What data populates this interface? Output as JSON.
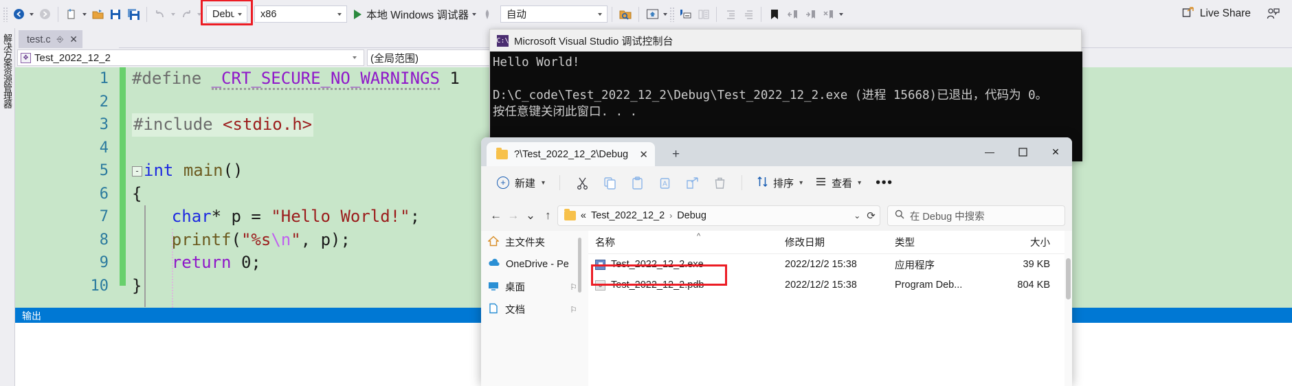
{
  "vs": {
    "toolbar": {
      "nav_back_icon": "navigate-back-icon",
      "nav_forward_icon": "navigate-forward-icon",
      "new_item_icon": "new-item-icon",
      "open_icon": "open-file-icon",
      "save_icon": "save-icon",
      "save_all_icon": "save-all-icon",
      "undo_icon": "undo-icon",
      "redo_icon": "redo-icon",
      "config_value": "Debug",
      "platform_value": "x86",
      "run_label": "本地 Windows 调试器",
      "hot_reload_icon": "hot-reload-icon",
      "auto_value": "自动",
      "find_in_files_icon": "find-in-files-icon",
      "window_layout_icon": "window-layout-icon",
      "comment_icon": "comment-icon",
      "uncomment_icon": "uncomment-icon",
      "indent_icon": "increase-indent-icon",
      "outdent_icon": "decrease-indent-icon",
      "bookmark_icon": "bookmark-icon",
      "prev_bookmark_icon": "previous-bookmark-icon",
      "next_bookmark_icon": "next-bookmark-icon",
      "clear_bookmark_icon": "clear-bookmarks-icon",
      "live_share_label": "Live Share",
      "live_share_icon": "live-share-icon",
      "feedback_icon": "send-feedback-icon"
    },
    "left_dock_label": "解决方案资源管理器",
    "tab": {
      "name": "test.c",
      "pin_icon": "pin-icon",
      "close_icon": "close-icon"
    },
    "navbar": {
      "type_value": "Test_2022_12_2",
      "type_icon": "project-icon",
      "scope_value": "(全局范围)"
    },
    "output_pane": {
      "tab_label": "输出"
    },
    "code": {
      "line_numbers": [
        "1",
        "2",
        "3",
        "4",
        "5",
        "6",
        "7",
        "8",
        "9",
        "10"
      ],
      "lines": [
        {
          "n": 1,
          "tokens": [
            {
              "t": "#define ",
              "c": "k-grey"
            },
            {
              "t": "_CRT_SECURE_NO_WARNINGS",
              "c": "k-macro squig"
            },
            {
              "t": " ",
              "c": "k-plain"
            },
            {
              "t": "1",
              "c": "k-plain"
            }
          ]
        },
        {
          "n": 2,
          "tokens": []
        },
        {
          "n": 3,
          "highlight": true,
          "tokens": [
            {
              "t": "#include ",
              "c": "k-grey"
            },
            {
              "t": "<stdio.h>",
              "c": "k-str"
            }
          ]
        },
        {
          "n": 4,
          "tokens": []
        },
        {
          "n": 5,
          "fold": "-",
          "tokens": [
            {
              "t": "int",
              "c": "k-blue"
            },
            {
              "t": " ",
              "c": "k-plain"
            },
            {
              "t": "main",
              "c": "k-fn"
            },
            {
              "t": "()",
              "c": "k-plain"
            }
          ]
        },
        {
          "n": 6,
          "tokens": [
            {
              "t": "{",
              "c": "k-plain"
            }
          ]
        },
        {
          "n": 7,
          "tokens": [
            {
              "t": "    ",
              "c": "k-plain"
            },
            {
              "t": "char",
              "c": "k-blue"
            },
            {
              "t": "* ",
              "c": "k-plain"
            },
            {
              "t": "p",
              "c": "k-plain"
            },
            {
              "t": " = ",
              "c": "k-plain"
            },
            {
              "t": "\"Hello World!\"",
              "c": "k-str"
            },
            {
              "t": ";",
              "c": "k-plain"
            }
          ]
        },
        {
          "n": 8,
          "tokens": [
            {
              "t": "    ",
              "c": "k-plain"
            },
            {
              "t": "printf",
              "c": "k-fn"
            },
            {
              "t": "(",
              "c": "k-plain"
            },
            {
              "t": "\"%s",
              "c": "k-str"
            },
            {
              "t": "\\n",
              "c": "k-esc"
            },
            {
              "t": "\"",
              "c": "k-str"
            },
            {
              "t": ", ",
              "c": "k-plain"
            },
            {
              "t": "p",
              "c": "k-plain"
            },
            {
              "t": ");",
              "c": "k-plain"
            }
          ]
        },
        {
          "n": 9,
          "tokens": [
            {
              "t": "    ",
              "c": "k-plain"
            },
            {
              "t": "return",
              "c": "k-purple"
            },
            {
              "t": " 0;",
              "c": "k-plain"
            }
          ]
        },
        {
          "n": 10,
          "tokens": [
            {
              "t": "}",
              "c": "k-plain"
            }
          ]
        }
      ]
    }
  },
  "console": {
    "title": "Microsoft Visual Studio 调试控制台",
    "icon": "console-app-icon",
    "line1": "Hello World!",
    "line2": "",
    "line3": "D:\\C_code\\Test_2022_12_2\\Debug\\Test_2022_12_2.exe (进程 15668)已退出，代码为 0。",
    "line4": "按任意键关闭此窗口. . ."
  },
  "explorer": {
    "tab_title": "?\\Test_2022_12_2\\Debug",
    "tab_folder_icon": "folder-icon",
    "tab_close_icon": "close-icon",
    "new_tab_icon": "new-tab-plus-icon",
    "minimize_icon": "minimize-icon",
    "maximize_icon": "maximize-icon",
    "close_icon": "window-close-icon",
    "minimize_glyph": "—",
    "maximize_glyph": "☐",
    "close_glyph": "✕",
    "toolbar": {
      "new_label": "新建",
      "new_icon": "new-plus-circle-icon",
      "cut_icon": "cut-icon",
      "copy_icon": "copy-icon",
      "paste_icon": "paste-icon",
      "rename_icon": "rename-icon",
      "share_icon": "share-icon",
      "delete_icon": "trash-icon",
      "sort_label": "排序",
      "sort_icon": "sort-arrows-icon",
      "view_label": "查看",
      "view_icon": "view-list-icon",
      "more_label": "•••",
      "more_icon": "more-options-icon"
    },
    "address": {
      "back_icon": "back-arrow-icon",
      "forward_icon": "forward-arrow-icon",
      "recent_icon": "recent-dropdown-icon",
      "up_icon": "up-arrow-icon",
      "folder_icon": "folder-icon",
      "prefix": "«",
      "crumb1": "Test_2022_12_2",
      "crumb2": "Debug",
      "separator": "›",
      "dropdown_icon": "chevron-down-icon",
      "refresh_icon": "refresh-icon",
      "refresh_glyph": "⟳",
      "search_icon": "search-icon",
      "search_placeholder": "在 Debug 中搜索"
    },
    "nav_items": [
      {
        "label": "主文件夹",
        "icon": "home-icon",
        "pinned": false
      },
      {
        "label": "OneDrive - Pe",
        "icon": "onedrive-icon",
        "pinned": false
      },
      {
        "label": "桌面",
        "icon": "desktop-icon",
        "pinned": true
      },
      {
        "label": "文档",
        "icon": "documents-icon",
        "pinned": true
      }
    ],
    "columns": [
      "名称",
      "修改日期",
      "类型",
      "大小"
    ],
    "rows": [
      {
        "name": "Test_2022_12_2.exe",
        "icon": "exe-file-icon",
        "date": "2022/12/2 15:38",
        "type": "应用程序",
        "size": "39 KB",
        "highlighted": true
      },
      {
        "name": "Test_2022_12_2.pdb",
        "icon": "pdb-file-icon",
        "date": "2022/12/2 15:38",
        "type": "Program Deb...",
        "size": "804 KB",
        "highlighted": false
      }
    ]
  },
  "colors": {
    "annotation_red": "#ec1c24",
    "vs_chrome": "#eeeef2",
    "editor_bg": "#c8e6c9",
    "changebar_green": "#68d06c",
    "console_bg": "#0c0c0c",
    "output_accent": "#0078d4",
    "accent_blue": "#1b5fb4"
  }
}
